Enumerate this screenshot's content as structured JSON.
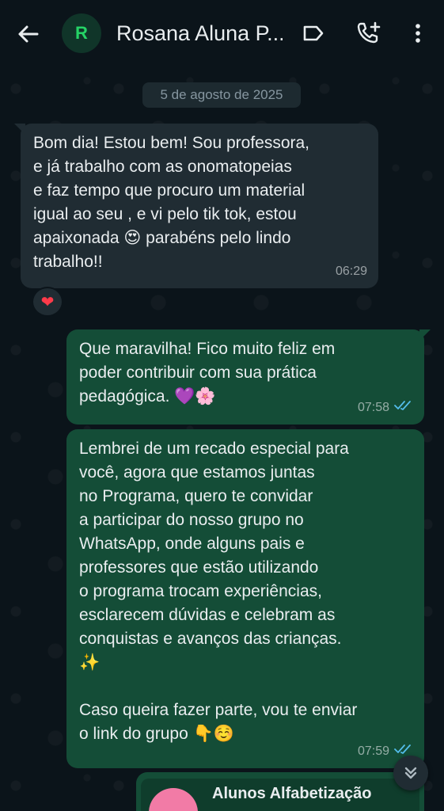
{
  "header": {
    "avatar_letter": "R",
    "contact_name": "Rosana Aluna P..."
  },
  "chat": {
    "date": "5 de agosto de 2025",
    "messages": [
      {
        "direction": "in",
        "text": "Bom dia! Estou bem! Sou professora,\ne já trabalho com as onomatopeias\ne faz tempo que procuro um material\nigual ao seu , e vi pelo tik tok, estou\napaixonada 😍 parabéns pelo lindo\ntrabalho!!",
        "time": "06:29",
        "reaction": "❤"
      },
      {
        "direction": "out",
        "text": "Que maravilha! Fico muito feliz em\npoder contribuir com sua prática\npedagógica. 💜🌸",
        "time": "07:58",
        "status": "read"
      },
      {
        "direction": "out",
        "text": "Lembrei de um recado especial para\nvocê, agora que estamos juntas\nno Programa, quero te convidar\na participar do nosso grupo no\nWhatsApp, onde alguns pais e\nprofessores que estão utilizando\no programa trocam experiências,\nesclarecem dúvidas e celebram as\nconquistas e avanços das crianças.\n✨\n\nCaso queira fazer parte, vou te enviar\no link do grupo 👇☺️",
        "time": "07:59",
        "status": "read"
      }
    ],
    "group_invite": {
      "title": "Alunos Alfabetização"
    }
  },
  "colors": {
    "background": "#0b141a",
    "incoming_bubble": "#202c33",
    "outgoing_bubble": "#144d37",
    "read_ticks": "#53bdeb",
    "avatar_letter": "#25d366"
  }
}
